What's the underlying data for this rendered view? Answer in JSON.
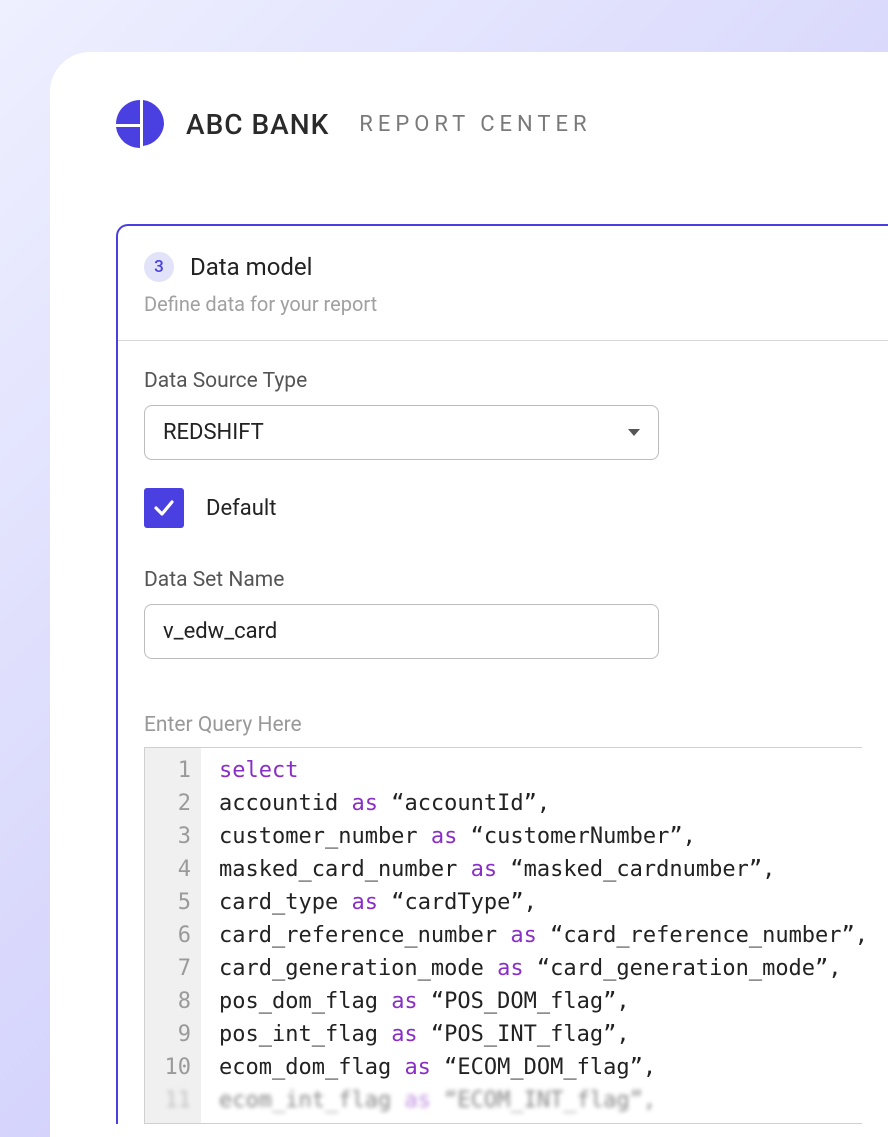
{
  "header": {
    "app_name": "ABC BANK",
    "subtitle": "REPORT CENTER"
  },
  "panel": {
    "step_number": "3",
    "step_title": "Data model",
    "step_desc": "Define data for your report"
  },
  "form": {
    "source_type_label": "Data Source Type",
    "source_type_value": "REDSHIFT",
    "default_label": "Default",
    "default_checked": true,
    "dataset_label": "Data Set Name",
    "dataset_value": "v_edw_card",
    "query_label": "Enter Query Here"
  },
  "query_lines": [
    {
      "n": "1",
      "pre": "",
      "kw": "select",
      "post": ""
    },
    {
      "n": "2",
      "pre": "accountid ",
      "kw": "as",
      "post": " “accountId”,"
    },
    {
      "n": "3",
      "pre": "customer_number ",
      "kw": "as",
      "post": " “customerNumber”,"
    },
    {
      "n": "4",
      "pre": "masked_card_number ",
      "kw": "as",
      "post": " “masked_cardnumber”,"
    },
    {
      "n": "5",
      "pre": "card_type ",
      "kw": "as",
      "post": " “cardType”,"
    },
    {
      "n": "6",
      "pre": "card_reference_number ",
      "kw": "as",
      "post": " “card_reference_number”,"
    },
    {
      "n": "7",
      "pre": "card_generation_mode ",
      "kw": "as",
      "post": " “card_generation_mode”,"
    },
    {
      "n": "8",
      "pre": "pos_dom_flag ",
      "kw": "as",
      "post": " “POS_DOM_flag”,"
    },
    {
      "n": "9",
      "pre": "pos_int_flag ",
      "kw": "as",
      "post": " “POS_INT_flag”,"
    },
    {
      "n": "10",
      "pre": "ecom_dom_flag ",
      "kw": "as",
      "post": " “ECOM_DOM_flag”,"
    },
    {
      "n": "11",
      "pre": "ecom_int_flag ",
      "kw": "as",
      "post": " “ECOM_INT_flag”,"
    }
  ]
}
